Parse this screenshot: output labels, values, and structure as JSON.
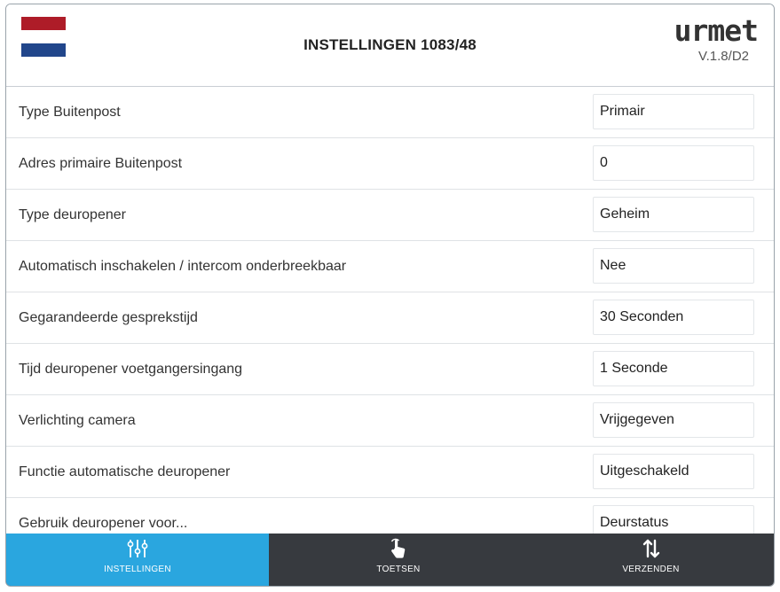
{
  "header": {
    "title": "INSTELLINGEN 1083/48",
    "brand": "urmet",
    "version": "V.1.8/D2",
    "flag_colors": [
      "#ae1c28",
      "#ffffff",
      "#21468b"
    ]
  },
  "settings": [
    {
      "label": "Type Buitenpost",
      "value": "Primair"
    },
    {
      "label": "Adres primaire Buitenpost",
      "value": "0"
    },
    {
      "label": "Type deuropener",
      "value": "Geheim"
    },
    {
      "label": "Automatisch inschakelen / intercom onderbreekbaar",
      "value": "Nee"
    },
    {
      "label": "Gegarandeerde gesprekstijd",
      "value": "30 Seconden"
    },
    {
      "label": "Tijd deuropener voetgangersingang",
      "value": "1 Seconde"
    },
    {
      "label": "Verlichting camera",
      "value": "Vrijgegeven"
    },
    {
      "label": "Functie automatische deuropener",
      "value": "Uitgeschakeld"
    },
    {
      "label": "Gebruik deuropener voor...",
      "value": "Deurstatus"
    }
  ],
  "nav": {
    "tabs": [
      {
        "label": "INSTELLINGEN",
        "icon": "sliders-icon",
        "active": true
      },
      {
        "label": "TOETSEN",
        "icon": "hand-pointer-icon",
        "active": false
      },
      {
        "label": "VERZENDEN",
        "icon": "transfer-arrows-icon",
        "active": false
      }
    ],
    "active_color": "#2aa6df",
    "bar_color": "#373a3f"
  }
}
